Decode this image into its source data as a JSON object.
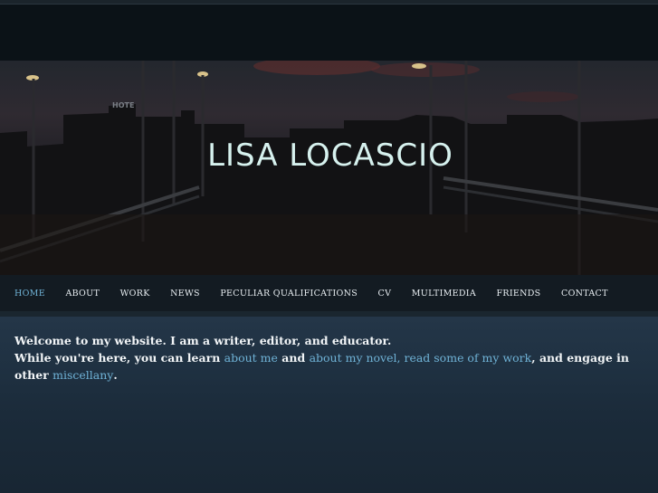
{
  "site": {
    "title": "LISA LOCASCIO"
  },
  "nav": {
    "items": [
      {
        "label": "HOME",
        "active": true
      },
      {
        "label": "ABOUT"
      },
      {
        "label": "WORK"
      },
      {
        "label": "NEWS"
      },
      {
        "label": "PECULIAR QUALIFICATIONS"
      },
      {
        "label": "CV"
      },
      {
        "label": "MULTIMEDIA"
      },
      {
        "label": "FRIENDS"
      },
      {
        "label": "CONTACT"
      }
    ]
  },
  "welcome": {
    "line1": "Welcome to my website. I am a writer, editor, and educator.",
    "line2_prefix": "While you're here, you can learn ",
    "link_about_me": "about me",
    "and1": " and ",
    "link_about_novel": "about my novel",
    "comma1": ", ",
    "link_read_work": "read some of my work",
    "comma2": ", and engage in other ",
    "link_miscellany": "miscellany",
    "period": "."
  },
  "colors": {
    "link": "#6fb2d6",
    "title": "#d6f1ee",
    "background": "#0d1419"
  },
  "icons": {
    "banner": "dusk-street-photo"
  }
}
